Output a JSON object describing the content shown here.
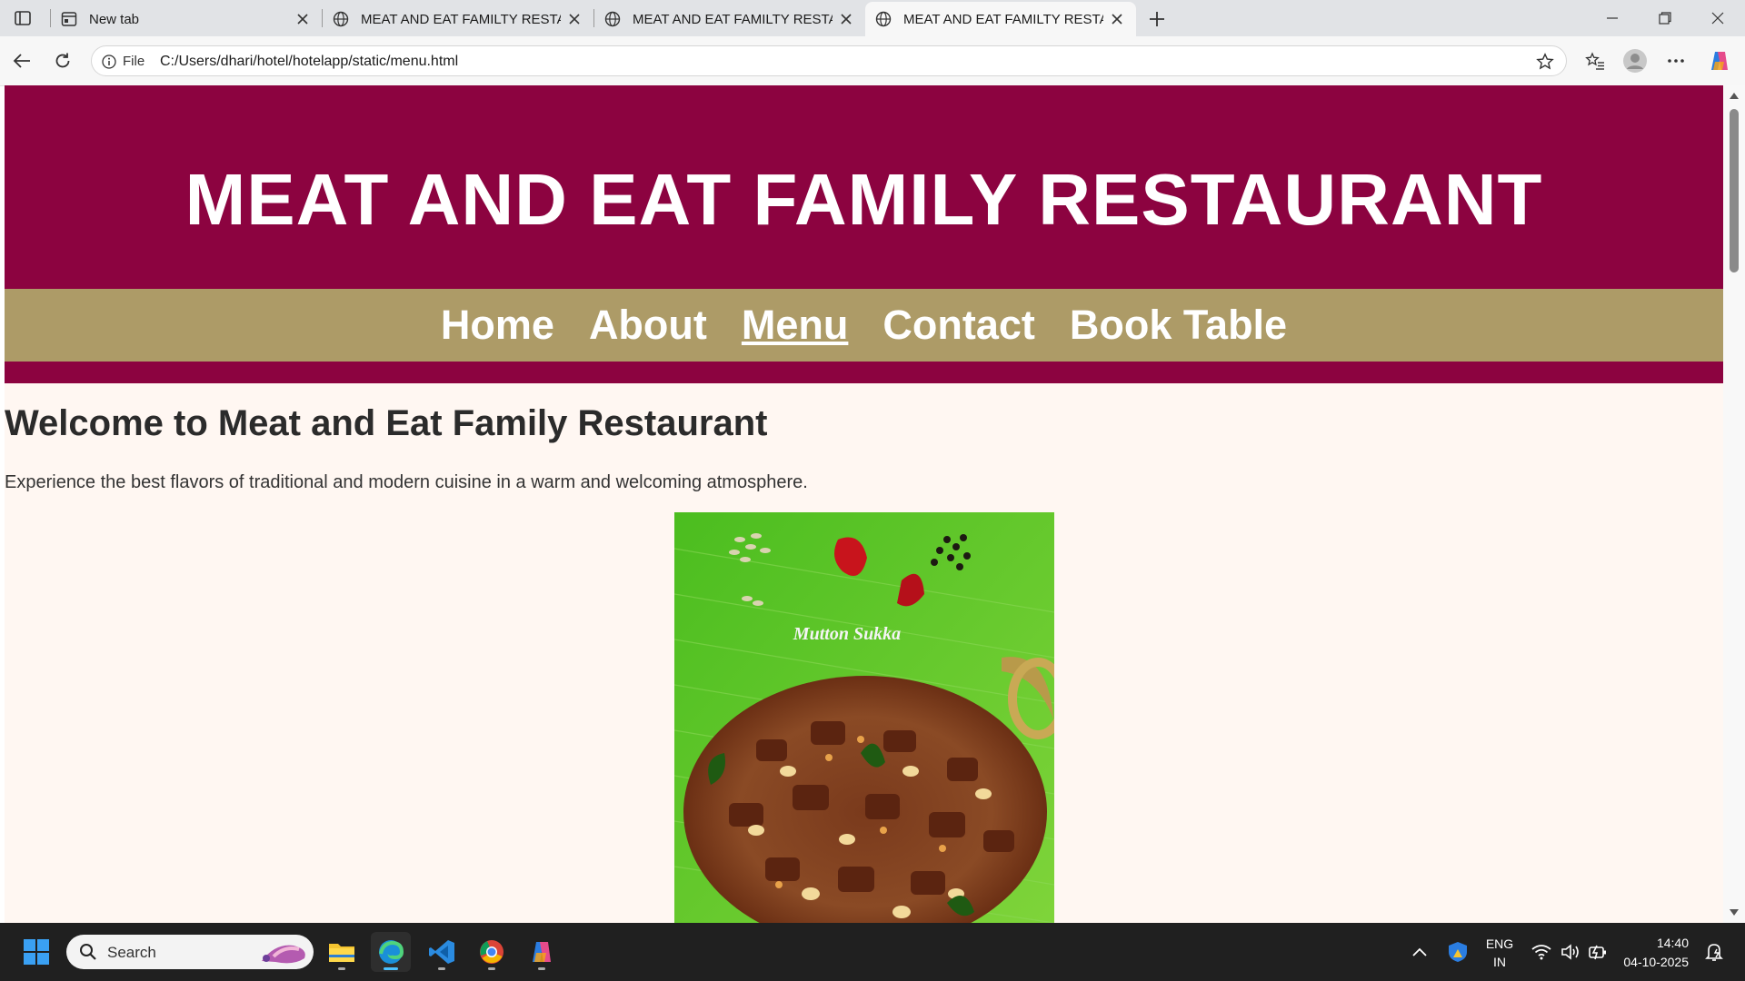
{
  "browser": {
    "tabs": [
      {
        "label": "New tab",
        "active": false
      },
      {
        "label": "MEAT AND EAT FAMILTY RESTAURANT",
        "active": false
      },
      {
        "label": "MEAT AND EAT FAMILTY RESTAURANT",
        "active": false
      },
      {
        "label": "MEAT AND EAT FAMILTY RESTAURANT",
        "active": true
      }
    ],
    "address": {
      "scheme_label": "File",
      "url": "C:/Users/dhari/hotel/hotelapp/static/menu.html"
    }
  },
  "site": {
    "title": "MEAT AND EAT FAMILY RESTAURANT",
    "nav": [
      {
        "label": "Home",
        "current": false
      },
      {
        "label": "About",
        "current": false
      },
      {
        "label": "Menu",
        "current": true
      },
      {
        "label": "Contact",
        "current": false
      },
      {
        "label": "Book Table",
        "current": false
      }
    ],
    "welcome_heading": "Welcome to Meat and Eat Family Restaurant",
    "intro_text": "Experience the best flavors of traditional and modern cuisine in a warm and welcoming atmosphere.",
    "dish_image": {
      "caption": "Mutton Sukka"
    },
    "colors": {
      "header": "#8c0340",
      "nav": "#ad9b67",
      "page_bg": "#fff7f2"
    }
  },
  "taskbar": {
    "search_placeholder": "Search",
    "language": "ENG",
    "region": "IN",
    "time": "14:40",
    "date": "04-10-2025"
  }
}
